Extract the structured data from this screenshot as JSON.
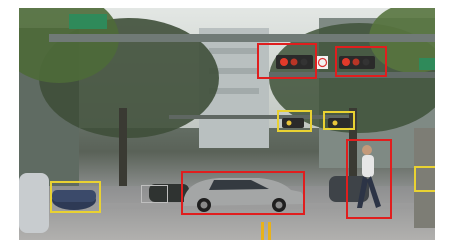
{
  "scene": {
    "description_label": "",
    "colors": {
      "detection_red": "#e01e1e",
      "detection_yellow": "#e9d232",
      "detection_gray": "#bfbfbf",
      "road_line_yellow": "#e8b21a"
    }
  },
  "detections": [
    {
      "name": "traffic-light-detection-1",
      "class": "traffic light",
      "color": "red"
    },
    {
      "name": "traffic-light-detection-2",
      "class": "traffic light",
      "color": "red"
    },
    {
      "name": "traffic-light-detection-3",
      "class": "traffic light",
      "color": "yellow"
    },
    {
      "name": "traffic-light-detection-4",
      "class": "traffic light",
      "color": "yellow"
    },
    {
      "name": "car-detection-main",
      "class": "car",
      "color": "red"
    },
    {
      "name": "pedestrian-detection",
      "class": "person",
      "color": "red"
    },
    {
      "name": "car-detection-left",
      "class": "car",
      "color": "yellow"
    },
    {
      "name": "car-detection-right",
      "class": "car",
      "color": "yellow"
    },
    {
      "name": "car-detection-small",
      "class": "car",
      "color": "gray"
    }
  ]
}
